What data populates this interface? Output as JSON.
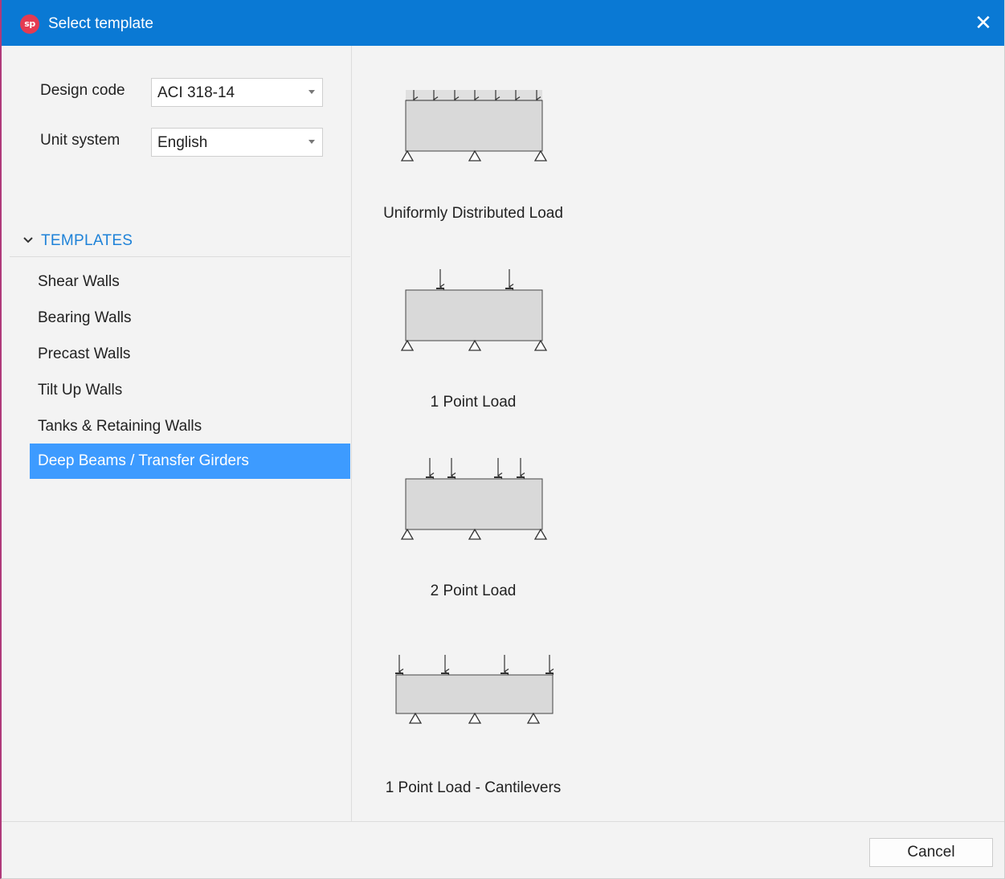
{
  "window": {
    "title": "Select template",
    "app_logo": "sp",
    "close_glyph": "✕"
  },
  "settings": {
    "design_code": {
      "label": "Design code",
      "value": "ACI 318-14"
    },
    "unit_system": {
      "label": "Unit system",
      "value": "English"
    }
  },
  "templates": {
    "header": "TEMPLATES",
    "expanded": true,
    "items": [
      {
        "label": "Shear Walls",
        "selected": false
      },
      {
        "label": "Bearing Walls",
        "selected": false
      },
      {
        "label": "Precast Walls",
        "selected": false
      },
      {
        "label": "Tilt Up Walls",
        "selected": false
      },
      {
        "label": "Tanks & Retaining Walls",
        "selected": false
      },
      {
        "label": "Deep Beams / Transfer Girders",
        "selected": true
      }
    ]
  },
  "cards": [
    {
      "label": "Uniformly Distributed Load",
      "icon": "deep-beam-udl-diagram"
    },
    {
      "label": "1 Point Load",
      "icon": "deep-beam-1-point-load-diagram"
    },
    {
      "label": "2 Point Load",
      "icon": "deep-beam-2-point-load-diagram"
    },
    {
      "label": "1 Point Load - Cantilevers",
      "icon": "deep-beam-cantilever-diagram"
    }
  ],
  "footer": {
    "cancel_label": "Cancel"
  },
  "colors": {
    "titlebar": "#0a79d4",
    "selected_item": "#3d9bff",
    "section_header": "#1e82d8",
    "beam_fill": "#d9d9d9"
  }
}
